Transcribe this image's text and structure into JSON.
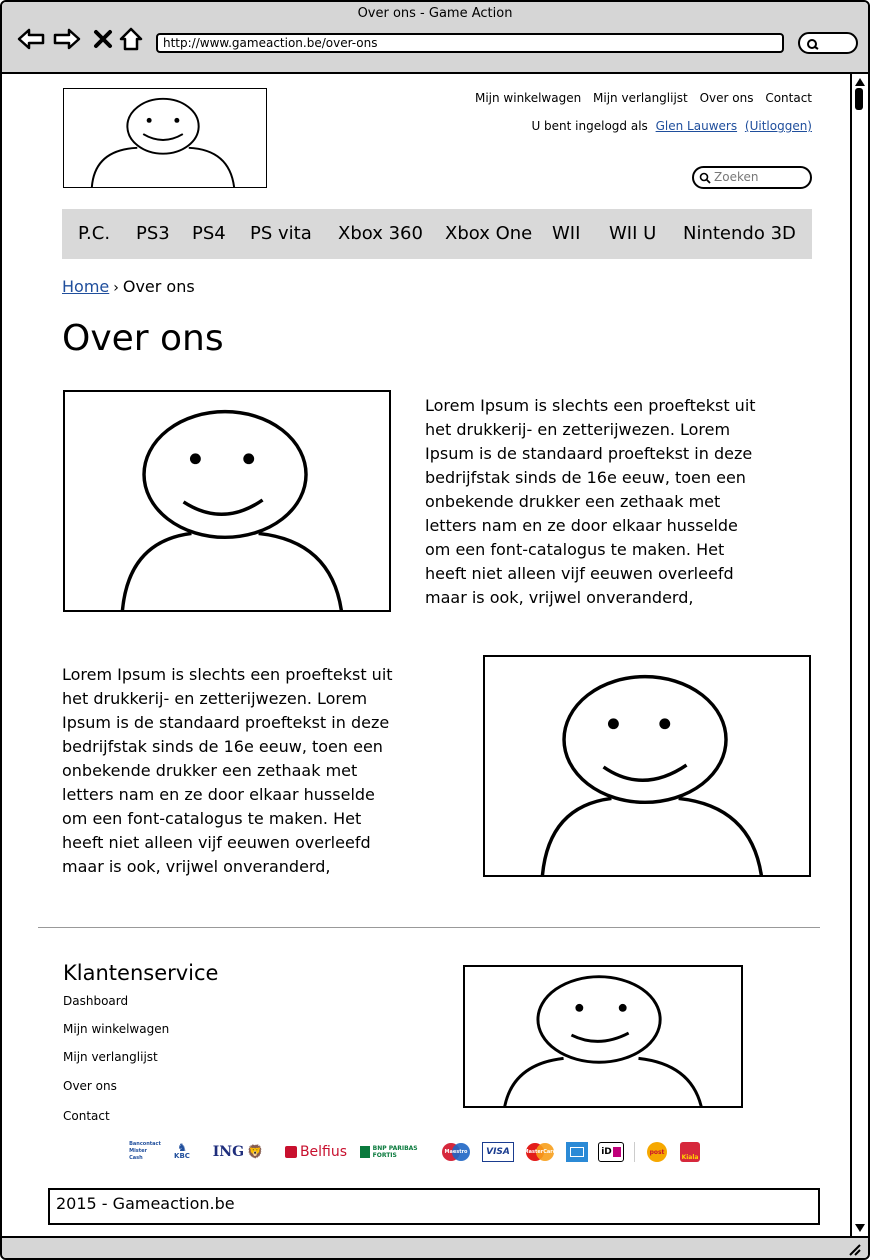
{
  "window": {
    "title": "Over ons - Game Action",
    "url": "http://www.gameaction.be/over-ons"
  },
  "header": {
    "top_links": [
      "Mijn winkelwagen",
      "Mijn verlanglijst",
      "Over ons",
      "Contact"
    ],
    "login_prefix": "U bent ingelogd als",
    "user_name": "Glen Lauwers",
    "logout": "(Uitloggen)",
    "search_placeholder": "Zoeken"
  },
  "nav": {
    "items": [
      "P.C.",
      "PS3",
      "PS4",
      "PS vita",
      "Xbox 360",
      "Xbox One",
      "WII",
      "WII U",
      "Nintendo 3D"
    ]
  },
  "breadcrumb": {
    "home": "Home",
    "current": "Over ons"
  },
  "page_title": "Over ons",
  "content": {
    "paragraph1_lines": [
      "Lorem Ipsum is slechts een proeftekst uit",
      "het drukkerij- en zetterijwezen. Lorem",
      "Ipsum is de standaard proeftekst in deze",
      "bedrijfstak sinds de 16e eeuw, toen een",
      "onbekende drukker een zethaak met",
      "letters nam en ze door elkaar husselde",
      "om een font-catalogus te maken. Het",
      "heeft niet alleen vijf eeuwen overleefd",
      "maar is ook, vrijwel onveranderd,"
    ],
    "paragraph2_lines": [
      "Lorem Ipsum is slechts een proeftekst uit",
      "het drukkerij- en zetterijwezen. Lorem",
      "Ipsum is de standaard proeftekst in deze",
      "bedrijfstak sinds de 16e eeuw, toen een",
      "onbekende drukker een zethaak met",
      "letters nam en ze door elkaar husselde",
      "om een font-catalogus te maken. Het",
      "heeft niet alleen vijf eeuwen overleefd",
      "maar is ook, vrijwel onveranderd,"
    ]
  },
  "footer": {
    "title": "Klantenservice",
    "links": [
      "Dashboard",
      "Mijn winkelwagen",
      "Mijn verlanglijst",
      "Over ons",
      "Contact"
    ],
    "payment_methods": [
      "Bancontact Mister Cash",
      "KBC",
      "ING",
      "Belfius",
      "BNP Paribas Fortis",
      "Maestro",
      "VISA",
      "MasterCard",
      "American Express",
      "iDEAL",
      "Postpay",
      "Klarna"
    ],
    "payment_labels": {
      "bancontact": "Bancontact Mister Cash",
      "kbc": "KBC",
      "ing": "ING",
      "belfius": "Belfius",
      "bnp": "BNP PARIBAS FORTIS",
      "maestro": "Maestro",
      "visa": "VISA",
      "mastercard": "MasterCard",
      "ideal": "iD",
      "post": "post",
      "kiala": "Kiala"
    },
    "copyright": "2015 - Gameaction.be"
  },
  "colors": {
    "link": "#1f4e9c",
    "nav_bg": "#d9d9d9",
    "chrome_bg": "#d6d6d6"
  }
}
